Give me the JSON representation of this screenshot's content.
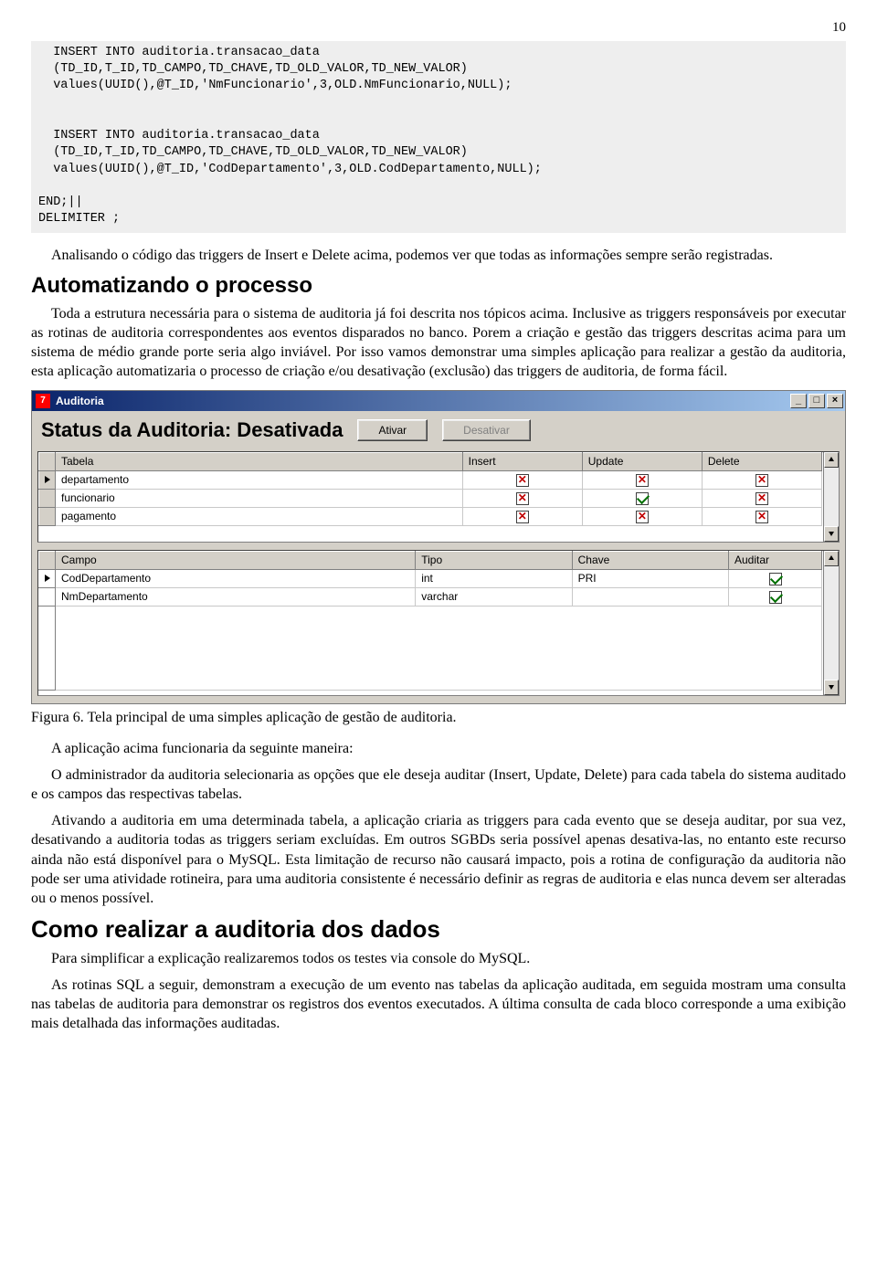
{
  "page_number": "10",
  "code_block1": "  INSERT INTO auditoria.transacao_data\n  (TD_ID,T_ID,TD_CAMPO,TD_CHAVE,TD_OLD_VALOR,TD_NEW_VALOR)\n  values(UUID(),@T_ID,'NmFuncionario',3,OLD.NmFuncionario,NULL);\n\n\n  INSERT INTO auditoria.transacao_data\n  (TD_ID,T_ID,TD_CAMPO,TD_CHAVE,TD_OLD_VALOR,TD_NEW_VALOR)\n  values(UUID(),@T_ID,'CodDepartamento',3,OLD.CodDepartamento,NULL);\n\nEND;||\nDELIMITER ;",
  "para1": "Analisando o código das triggers de Insert e Delete acima, podemos ver que todas as informações sempre serão registradas.",
  "heading1": "Automatizando o processo",
  "para2": "Toda a estrutura necessária para o sistema de auditoria já foi descrita nos tópicos acima. Inclusive as triggers responsáveis por executar as rotinas de auditoria correspondentes aos eventos disparados no banco. Porem a criação e gestão das triggers descritas acima para um sistema de médio grande porte seria algo inviável. Por isso vamos demonstrar uma simples aplicação para realizar a gestão da auditoria, esta aplicação automatizaria o processo de criação e/ou desativação (exclusão) das triggers de auditoria, de forma fácil.",
  "app": {
    "title": "Auditoria",
    "status_label": "Status da Auditoria: Desativada",
    "btn_ativar": "Ativar",
    "btn_desativar": "Desativar",
    "grid1": {
      "headers": {
        "tabela": "Tabela",
        "insert": "Insert",
        "update": "Update",
        "delete": "Delete"
      },
      "rows": [
        {
          "tabela": "departamento",
          "insert": "no",
          "update": "no",
          "delete": "no",
          "current": true
        },
        {
          "tabela": "funcionario",
          "insert": "no",
          "update": "yes",
          "delete": "no",
          "current": false
        },
        {
          "tabela": "pagamento",
          "insert": "no",
          "update": "no",
          "delete": "no",
          "current": false
        }
      ]
    },
    "grid2": {
      "headers": {
        "campo": "Campo",
        "tipo": "Tipo",
        "chave": "Chave",
        "auditar": "Auditar"
      },
      "rows": [
        {
          "campo": "CodDepartamento",
          "tipo": "int",
          "chave": "PRI",
          "auditar": "yes",
          "current": true
        },
        {
          "campo": "NmDepartamento",
          "tipo": "varchar",
          "chave": "",
          "auditar": "yes",
          "current": false
        }
      ]
    }
  },
  "caption": "Figura 6. Tela principal de uma simples aplicação de gestão de auditoria.",
  "para3": "A aplicação acima funcionaria da seguinte maneira:",
  "para4": "O administrador da auditoria selecionaria as opções que ele deseja auditar (Insert, Update, Delete) para cada tabela do sistema auditado e os campos das respectivas tabelas.",
  "para5": "Ativando a auditoria em uma determinada tabela, a aplicação criaria as triggers para cada evento que se deseja auditar, por sua vez, desativando a auditoria todas as triggers seriam excluídas. Em outros SGBDs seria possível apenas desativa-las, no entanto este recurso ainda não está disponível para o MySQL. Esta limitação de recurso não causará impacto, pois a rotina de configuração da auditoria não pode ser uma atividade rotineira, para uma auditoria consistente é necessário definir as regras de auditoria e elas nunca devem ser alteradas ou o menos possível.",
  "heading2": "Como realizar a auditoria dos dados",
  "para6": "Para simplificar a explicação realizaremos todos os testes via console do MySQL.",
  "para7": "As rotinas SQL a seguir, demonstram a execução de um evento nas tabelas da aplicação auditada, em seguida mostram uma consulta nas tabelas de auditoria para demonstrar os registros dos eventos executados. A última consulta de cada bloco corresponde a uma exibição mais detalhada das informações auditadas."
}
